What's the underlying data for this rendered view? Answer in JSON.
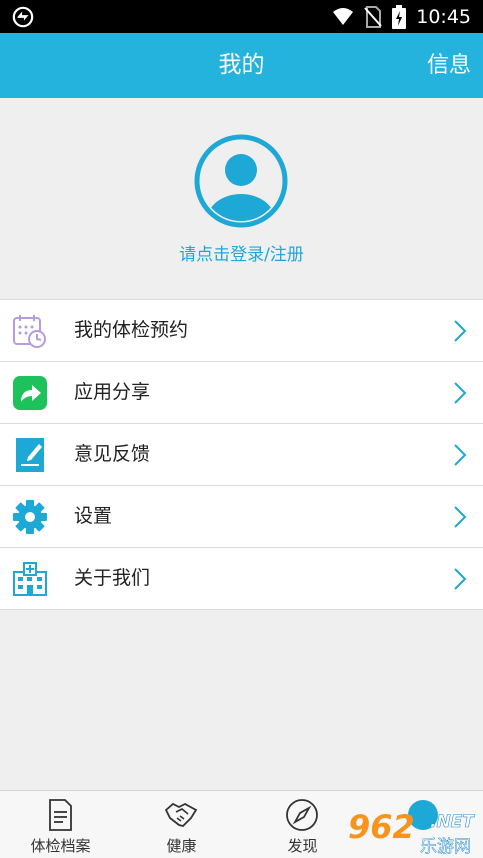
{
  "status_bar": {
    "time": "10:45"
  },
  "header": {
    "title": "我的",
    "right_action": "信息",
    "background_color": "#23b3dc"
  },
  "profile": {
    "login_prompt": "请点击登录/注册",
    "avatar_icon": "user-avatar-icon"
  },
  "menu": {
    "items": [
      {
        "label": "我的体检预约",
        "icon": "calendar-clock-icon"
      },
      {
        "label": "应用分享",
        "icon": "share-icon"
      },
      {
        "label": "意见反馈",
        "icon": "feedback-icon"
      },
      {
        "label": "设置",
        "icon": "gear-icon"
      },
      {
        "label": "关于我们",
        "icon": "hospital-icon"
      }
    ]
  },
  "tabs": [
    {
      "label": "体检档案",
      "icon": "document-icon"
    },
    {
      "label": "健康",
      "icon": "handshake-icon"
    },
    {
      "label": "发现",
      "icon": "compass-icon"
    },
    {
      "label": "",
      "icon": "user-tab-icon"
    }
  ],
  "watermark": {
    "digits": "962",
    "suffix": ".NET",
    "cn": "乐游网"
  },
  "colors": {
    "accent": "#23b3dc",
    "link": "#1ea8d6",
    "share_green": "#1ec25a"
  }
}
